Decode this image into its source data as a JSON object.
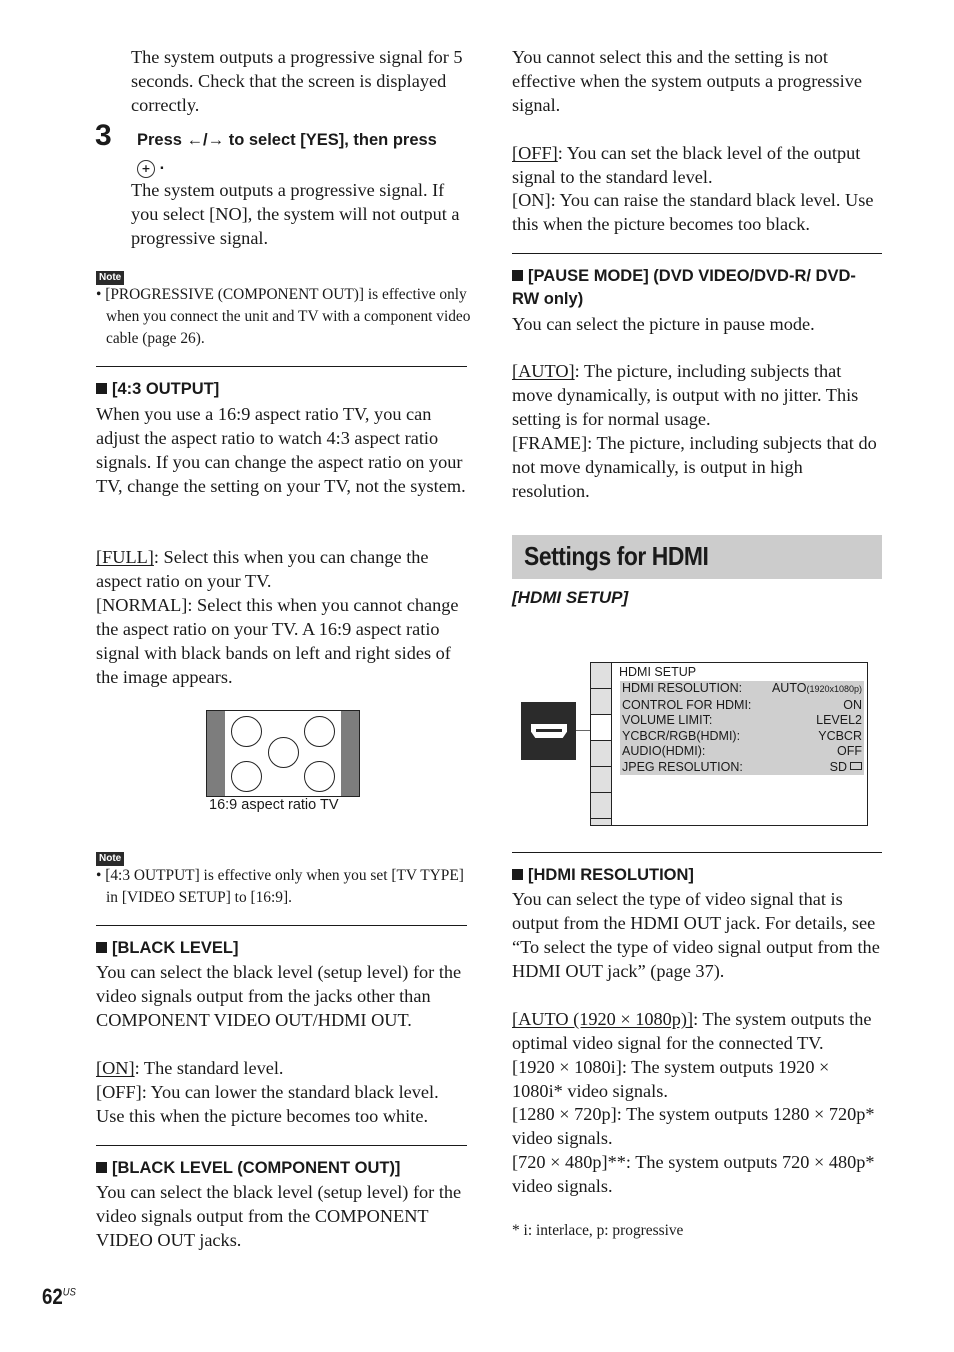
{
  "left_column": {
    "intro_para": "The system outputs a progressive signal for 5 seconds. Check that the screen is displayed correctly.",
    "step3": {
      "number": "3",
      "instruction": "Press ←/→ to select [YES], then press",
      "enter_icon": "enter-button-icon",
      "after": ".",
      "body": "The system outputs a progressive signal. If you select [NO], the system will not output a progressive signal."
    },
    "note1": {
      "badge": "Note",
      "text": "• [PROGRESSIVE (COMPONENT OUT)] is effective only when you connect the unit and TV with a component video cable (page 26)."
    },
    "section_43": {
      "heading": "[4:3 OUTPUT]",
      "body": "When you use a 16:9 aspect ratio TV, you can adjust the aspect ratio to watch 4:3 aspect ratio signals. If you can change the aspect ratio on your TV, change the setting on your TV, not the system.",
      "option1_label": "[FULL]",
      "option1_text": ": Select this when you can change the aspect ratio on your TV.",
      "option2": "[NORMAL]: Select this when you cannot change the aspect ratio on your TV. A 16:9 aspect ratio signal with black bands on left and right sides of the image appears.",
      "figure_caption": "16:9 aspect ratio TV"
    },
    "note2": {
      "badge": "Note",
      "text": "• [4:3 OUTPUT] is effective only when you set [TV TYPE] in [VIDEO SETUP] to [16:9]."
    },
    "section_black": {
      "heading": "[BLACK LEVEL]",
      "body": "You can select the black level (setup level) for the video signals output from the jacks other than COMPONENT VIDEO OUT/HDMI OUT.",
      "option1_label": "[ON]",
      "option1_text": ": The standard level.",
      "option2": "[OFF]: You can lower the standard black level. Use this when the picture becomes too white."
    },
    "section_black_comp": {
      "heading": "[BLACK LEVEL (COMPONENT OUT)]",
      "body": "You can select the black level (setup level) for the video signals output from the COMPONENT VIDEO OUT jacks."
    }
  },
  "right_column": {
    "intro_para": "You cannot select this and the setting is not effective when the system outputs a progressive signal.",
    "off_label": "[OFF]",
    "off_text": ": You can set the black level of the output signal to the standard level.",
    "on_text": "[ON]: You can raise the standard black level. Use this when the picture becomes too black.",
    "section_pause": {
      "heading": "[PAUSE MODE] (DVD VIDEO/DVD-R/ DVD-RW only)",
      "body": "You can select the picture in pause mode.",
      "option1_label": "[AUTO]",
      "option1_text": ": The picture, including subjects that move dynamically, is output with no jitter. This setting is for normal usage.",
      "option2": "[FRAME]: The picture, including subjects that do not move dynamically, is output in high resolution."
    },
    "banner_title": "Settings for HDMI",
    "subheading": "[HDMI SETUP]",
    "osd": {
      "title": "HDMI SETUP",
      "rows": [
        {
          "label": "HDMI RESOLUTION:",
          "value": "AUTO",
          "value_small": "(1920x1080p)"
        },
        {
          "label": "CONTROL FOR HDMI:",
          "value": "ON"
        },
        {
          "label": "VOLUME LIMIT:",
          "value": "LEVEL2"
        },
        {
          "label": "YCBCR/RGB(HDMI):",
          "value": "YCBCR"
        },
        {
          "label": "AUDIO(HDMI):",
          "value": "OFF"
        },
        {
          "label": "JPEG RESOLUTION:",
          "value": "SD"
        }
      ],
      "selected_tab_index": 2,
      "tab_count": 6
    },
    "section_res": {
      "heading": "[HDMI RESOLUTION]",
      "body": "You can select the type of video signal that is output from the HDMI OUT jack. For details, see “To select the type of video signal output from the HDMI OUT jack” (page 37).",
      "option1_label": "[AUTO (1920 × 1080p)]",
      "option1_text": ": The system outputs the optimal video signal for the connected TV.",
      "option2": "[1920 × 1080i]: The system outputs 1920 × 1080i* video signals.",
      "option3": "[1280 × 720p]: The system outputs 1280 × 720p* video signals.",
      "option4": "[720 × 480p]**: The system outputs 720 × 480p* video signals.",
      "footnote": "*  i: interlace, p: progressive"
    }
  },
  "page_number": "62",
  "page_suffix": "US"
}
